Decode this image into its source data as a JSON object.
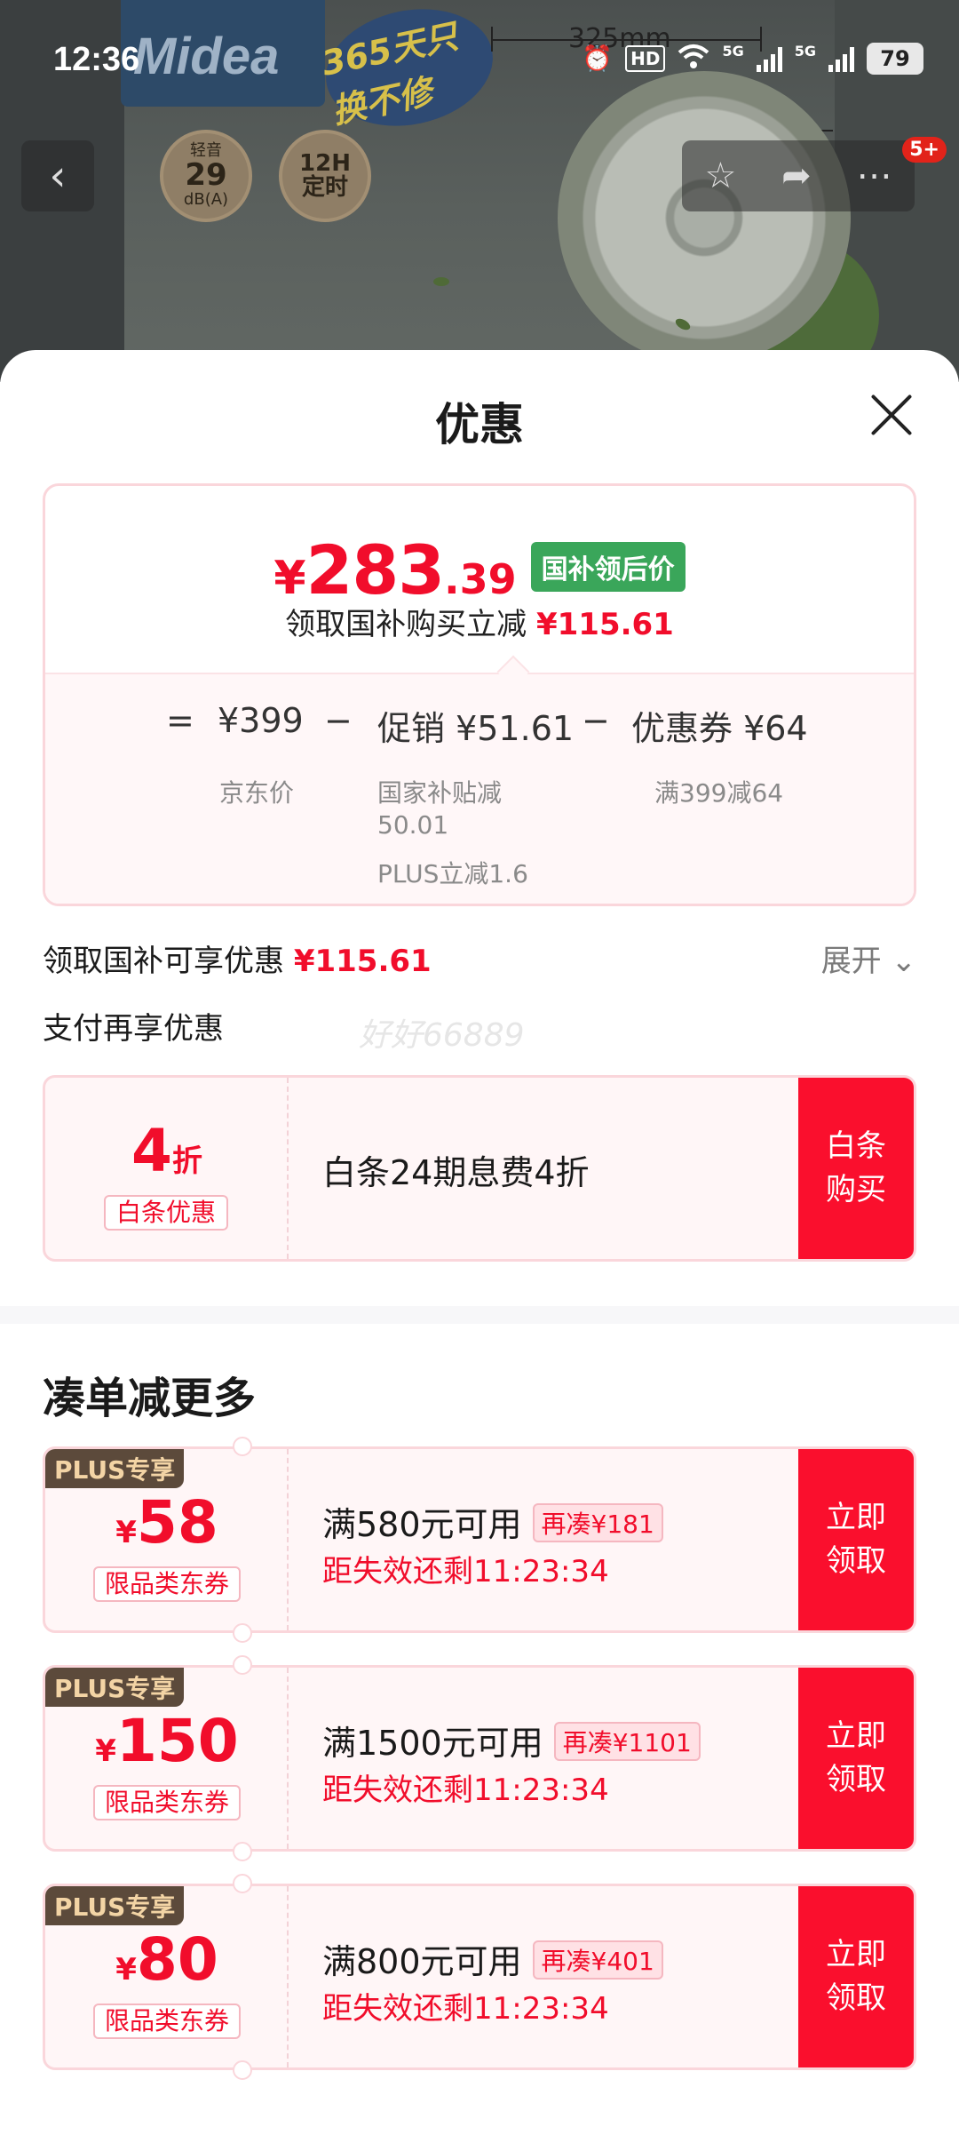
{
  "status_bar": {
    "time": "12:36",
    "hd_label": "HD",
    "net_label_1": "5G",
    "net_label_2": "5G",
    "battery": "79"
  },
  "product": {
    "brand": "Midea",
    "promo_badge": "365天只换不修",
    "dimension_label": "325mm",
    "feature_1_small": "轻音",
    "feature_1_big": "29",
    "feature_1_unit": "dB(A)",
    "feature_2_top": "12H",
    "feature_2_bottom": "定时"
  },
  "nav": {
    "back_icon": "chevron-left-icon",
    "message_badge": "5+"
  },
  "sheet": {
    "title": "优惠",
    "price": {
      "currency": "¥",
      "integer": "283",
      "decimal": ".39",
      "tag": "国补领后价",
      "subtitle_prefix": "领取国补购买立减",
      "subtitle_amount": "¥115.61"
    },
    "calc": {
      "eq": "=",
      "jd_price": "¥399",
      "minus_1": "−",
      "promo": "促销 ¥51.61",
      "minus_2": "−",
      "coupon": "优惠券 ¥64",
      "jd_price_label": "京东价",
      "promo_detail_1": "国家补贴减",
      "promo_detail_2": "50.01",
      "promo_detail_3": "PLUS立减1.6",
      "coupon_detail": "满399减64"
    },
    "subsidy_row": {
      "label": "领取国补可享优惠",
      "amount": "¥115.61",
      "expand": "展开"
    },
    "pay_row_label": "支付再享优惠",
    "watermark": "好好66889",
    "baitiao": {
      "discount_num": "4",
      "discount_unit": "折",
      "tag": "白条优惠",
      "description": "白条24期息费4折",
      "action": "白条\n购买"
    },
    "more_title": "凑单减更多",
    "coupons": [
      {
        "plus_tag": "PLUS专享",
        "currency": "¥",
        "amount": "58",
        "type": "限品类东券",
        "condition": "满580元可用",
        "need": "再凑¥181",
        "countdown": "距失效还剩11:23:34",
        "action": "立即\n领取"
      },
      {
        "plus_tag": "PLUS专享",
        "currency": "¥",
        "amount": "150",
        "type": "限品类东券",
        "condition": "满1500元可用",
        "need": "再凑¥1101",
        "countdown": "距失效还剩11:23:34",
        "action": "立即\n领取"
      },
      {
        "plus_tag": "PLUS专享",
        "currency": "¥",
        "amount": "80",
        "type": "限品类东券",
        "condition": "满800元可用",
        "need": "再凑¥401",
        "countdown": "距失效还剩11:23:34",
        "action": "立即\n领取"
      }
    ]
  },
  "colors": {
    "accent_red": "#f10d2b",
    "subsidy_green": "#3aa65a",
    "plus_brown": "#5c4a3b"
  }
}
